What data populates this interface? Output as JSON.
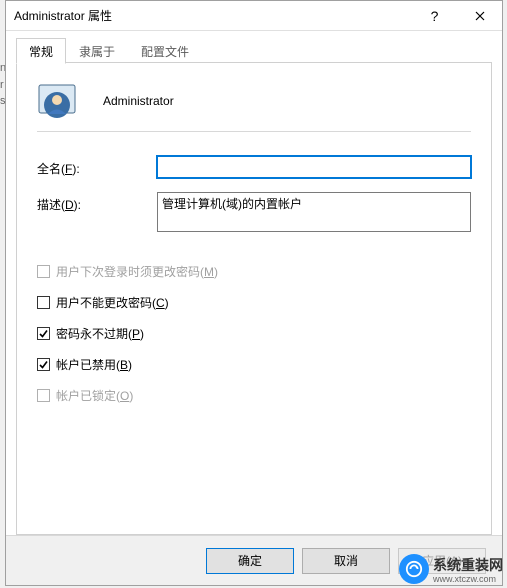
{
  "window": {
    "title": "Administrator 属性",
    "help_symbol": "?",
    "close_symbol": "×"
  },
  "tabs": {
    "general": "常规",
    "memberof": "隶属于",
    "profile": "配置文件"
  },
  "header": {
    "username": "Administrator"
  },
  "fields": {
    "fullname_label_pre": "全名(",
    "fullname_key": "F",
    "fullname_label_post": "):",
    "fullname_value": "",
    "desc_label_pre": "描述(",
    "desc_key": "D",
    "desc_label_post": "):",
    "desc_value": "管理计算机(域)的内置帐户"
  },
  "checks": {
    "mustchange_pre": "用户下次登录时须更改密码(",
    "mustchange_key": "M",
    "mustchange_post": ")",
    "cannotchange_pre": "用户不能更改密码(",
    "cannotchange_key": "C",
    "cannotchange_post": ")",
    "neverexpire_pre": "密码永不过期(",
    "neverexpire_key": "P",
    "neverexpire_post": ")",
    "disabled_pre": "帐户已禁用(",
    "disabled_key": "B",
    "disabled_post": ")",
    "locked_pre": "帐户已锁定(",
    "locked_key": "O",
    "locked_post": ")"
  },
  "buttons": {
    "ok": "确定",
    "cancel": "取消",
    "apply_pre": "应用(",
    "apply_key": "A",
    "apply_post": ")"
  },
  "watermark": {
    "text": "系统重装网",
    "url": "www.xtczw.com"
  }
}
